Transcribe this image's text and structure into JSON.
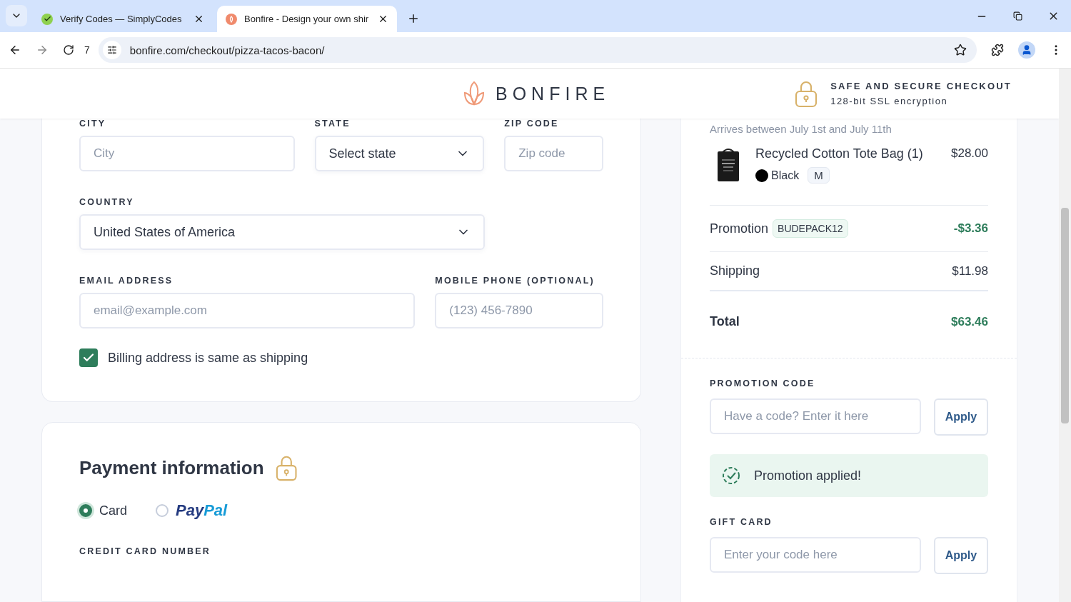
{
  "browser": {
    "tabs": [
      {
        "title": "Verify Codes — SimplyCodes",
        "selected": false
      },
      {
        "title": "Bonfire - Design your own shir",
        "selected": true
      }
    ],
    "tab_count": "7",
    "address": "bonfire.com/checkout/pizza-tacos-bacon/"
  },
  "header": {
    "brand": "BONFIRE",
    "secure_title": "SAFE AND SECURE CHECKOUT",
    "secure_subtitle": "128-bit SSL encryption"
  },
  "address_form": {
    "city": {
      "label": "CITY",
      "placeholder": "City"
    },
    "state": {
      "label": "STATE",
      "value": "Select state"
    },
    "zip": {
      "label": "ZIP CODE",
      "placeholder": "Zip code"
    },
    "country": {
      "label": "COUNTRY",
      "value": "United States of America"
    },
    "email": {
      "label": "EMAIL ADDRESS",
      "placeholder": "email@example.com"
    },
    "phone": {
      "label": "MOBILE PHONE (OPTIONAL)",
      "placeholder": "(123) 456-7890"
    },
    "billing_same": {
      "label": "Billing address is same as shipping",
      "checked": true
    }
  },
  "payment": {
    "title": "Payment information",
    "methods": [
      {
        "kind": "text",
        "label": "Card",
        "selected": true
      },
      {
        "kind": "paypal",
        "parts": [
          "Pay",
          "Pal"
        ],
        "selected": false
      }
    ],
    "card_number_label": "CREDIT CARD NUMBER"
  },
  "summary": {
    "arrival": "Arrives between July 1st and July 11th",
    "item": {
      "name": "Recycled Cotton Tote Bag (1)",
      "price": "$28.00",
      "color_name": "Black",
      "color": "#000000",
      "size": "M"
    },
    "promotion": {
      "label": "Promotion",
      "code": "BUDEPACK12",
      "amount": "-$3.36"
    },
    "shipping": {
      "label": "Shipping",
      "amount": "$11.98"
    },
    "total": {
      "label": "Total",
      "amount": "$63.46"
    },
    "promo_code": {
      "label": "PROMOTION CODE",
      "placeholder": "Have a code? Enter it here",
      "button": "Apply"
    },
    "promo_message": "Promotion applied!",
    "gift_card": {
      "label": "GIFT CARD",
      "placeholder": "Enter your code here",
      "button": "Apply"
    }
  }
}
